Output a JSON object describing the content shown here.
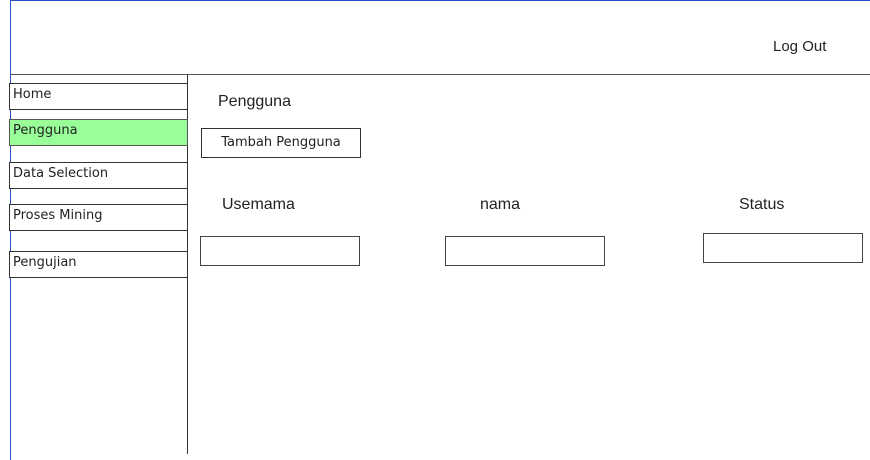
{
  "header": {
    "logout_label": "Log Out"
  },
  "sidebar": {
    "items": [
      {
        "label": "Home",
        "active": false
      },
      {
        "label": "Pengguna",
        "active": true
      },
      {
        "label": "Data Selection",
        "active": false
      },
      {
        "label": "Proses Mining",
        "active": false
      },
      {
        "label": "Pengujian",
        "active": false
      }
    ],
    "active_color": "#99ff99"
  },
  "main": {
    "title": "Pengguna",
    "add_button_label": "Tambah Pengguna",
    "columns": [
      {
        "label": "Usemama",
        "value": ""
      },
      {
        "label": "nama",
        "value": ""
      },
      {
        "label": "Status",
        "value": ""
      }
    ]
  }
}
